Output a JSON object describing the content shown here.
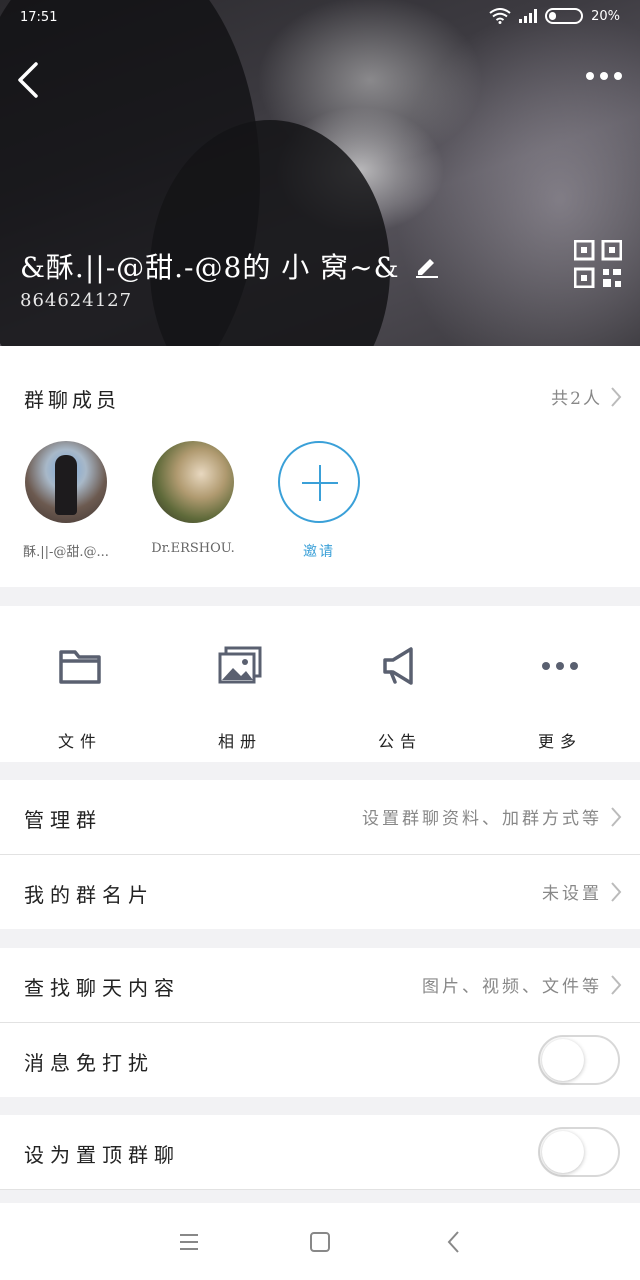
{
  "status_bar": {
    "time": "17:51",
    "battery": "20%"
  },
  "header": {
    "group_name": "&酥.||-@甜.-@8的 小 窝~&",
    "group_id": "864624127"
  },
  "members": {
    "title": "群聊成员",
    "count_text": "共2人",
    "list": [
      {
        "name": "酥.||-@甜.@..."
      },
      {
        "name": "Dr.ERSHOU."
      }
    ],
    "invite_label": "邀请"
  },
  "tools": [
    {
      "label": "文件",
      "icon": "folder-icon"
    },
    {
      "label": "相册",
      "icon": "album-icon"
    },
    {
      "label": "公告",
      "icon": "megaphone-icon"
    },
    {
      "label": "更多",
      "icon": "more-icon"
    }
  ],
  "rows": {
    "manage": {
      "label": "管理群",
      "value": "设置群聊资料、加群方式等"
    },
    "card": {
      "label": "我的群名片",
      "value": "未设置"
    },
    "search": {
      "label": "查找聊天内容",
      "value": "图片、视频、文件等"
    },
    "mute": {
      "label": "消息免打扰",
      "on": false
    },
    "pin": {
      "label": "设为置顶群聊",
      "on": false
    }
  },
  "colors": {
    "accent": "#3aa0d8"
  }
}
